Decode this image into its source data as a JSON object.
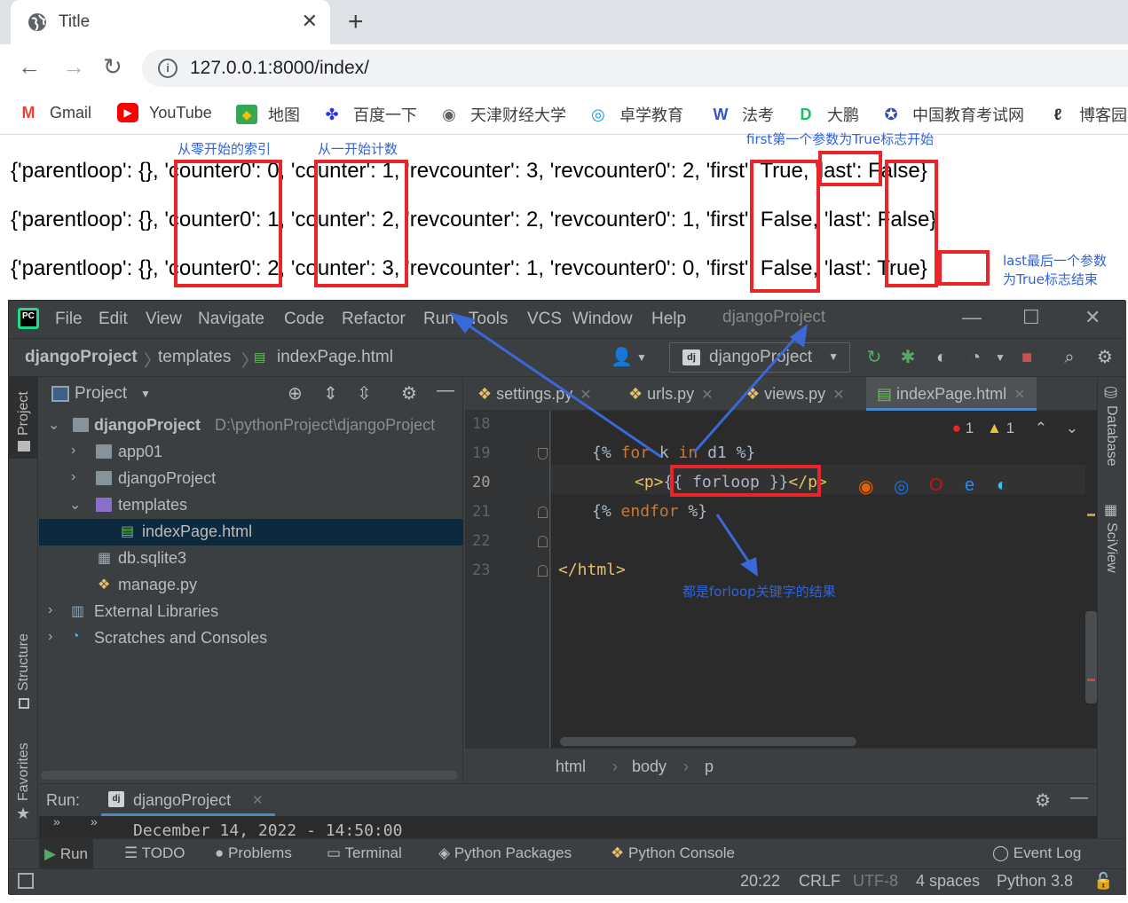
{
  "browser": {
    "tab_title": "Title",
    "url": "127.0.0.1:8000/index/",
    "bookmarks": [
      "Gmail",
      "YouTube",
      "地图",
      "百度一下",
      "天津财经大学",
      "卓学教育",
      "法考",
      "大鹏",
      "中国教育考试网",
      "博客园"
    ]
  },
  "page": {
    "rows": [
      {
        "pre": "{'parentloop': {}, ",
        "c0k": "'counter0'",
        "c0v": ": 0, ",
        "ck": "'counter'",
        "cv": ": 1, 'revcounter': 3, 'revcounter0': 2, ",
        "fk": "'first'",
        "fv": ": True, ",
        "lk": "'last'",
        "lv": ": False}"
      },
      {
        "pre": "{'parentloop': {}, ",
        "c0k": "'counter0'",
        "c0v": ": 1, ",
        "ck": "'counter'",
        "cv": ": 2, 'revcounter': 2, 'revcounter0': 1, ",
        "fk": "'first'",
        "fv": ": False, ",
        "lk": "'last'",
        "lv": ": False}"
      },
      {
        "pre": "{'parentloop': {}, ",
        "c0k": "'counter0'",
        "c0v": ": 2, ",
        "ck": "'counter'",
        "cv": ": 3, 'revcounter': 1, 'revcounter0': 0, ",
        "fk": "'first'",
        "fv": ": False, ",
        "lk": "'last'",
        "lv": ": True}"
      }
    ],
    "annotations": {
      "counter0": "从零开始的索引",
      "counter": "从一开始计数",
      "first": "first第一个参数为True标志开始",
      "last_line1": "last最后一个参数",
      "last_line2": "为True标志结束",
      "forloop": "都是forloop关键字的结果"
    }
  },
  "ide": {
    "menu": [
      "File",
      "Edit",
      "View",
      "Navigate",
      "Code",
      "Refactor",
      "Run",
      "Tools",
      "VCS",
      "Window",
      "Help"
    ],
    "window_title": "djangoProject",
    "breadcrumbs": [
      "djangoProject",
      "templates",
      "indexPage.html"
    ],
    "run_config": "djangoProject",
    "left_tools": [
      "Project",
      "Structure",
      "Favorites"
    ],
    "right_tools": [
      "Database",
      "SciView"
    ],
    "project_panel": {
      "title": "Project",
      "root": "djangoProject",
      "root_path": "D:\\pythonProject\\djangoProject",
      "items": [
        "app01",
        "djangoProject",
        "templates",
        "indexPage.html",
        "db.sqlite3",
        "manage.py",
        "External Libraries",
        "Scratches and Consoles"
      ]
    },
    "editor_tabs": [
      "settings.py",
      "urls.py",
      "views.py",
      "indexPage.html"
    ],
    "line_numbers": [
      "18",
      "19",
      "20",
      "21",
      "22",
      "23"
    ],
    "code": {
      "l19_a": "{% ",
      "l19_kw1": "for",
      "l19_b": " k ",
      "l19_kw2": "in",
      "l19_c": " d1 %}",
      "l20_tag1": "<p>",
      "l20_mid": "{{ forloop }}",
      "l20_tag2": "</p>",
      "l21_a": "{% ",
      "l21_kw": "endfor",
      "l21_b": " %}",
      "l23_tag": "</html>"
    },
    "inspections": {
      "errors": "1",
      "warnings": "1"
    },
    "code_breadcrumbs": [
      "html",
      "body",
      "p"
    ],
    "run": {
      "label": "Run:",
      "tab": "djangoProject",
      "console": "December 14, 2022 - 14:50:00"
    },
    "bottom_tools": [
      "Run",
      "TODO",
      "Problems",
      "Terminal",
      "Python Packages",
      "Python Console",
      "Event Log"
    ],
    "status": {
      "position": "20:22",
      "line_sep": "CRLF",
      "encoding": "UTF-8",
      "indent": "4 spaces",
      "interpreter": "Python 3.8"
    }
  }
}
